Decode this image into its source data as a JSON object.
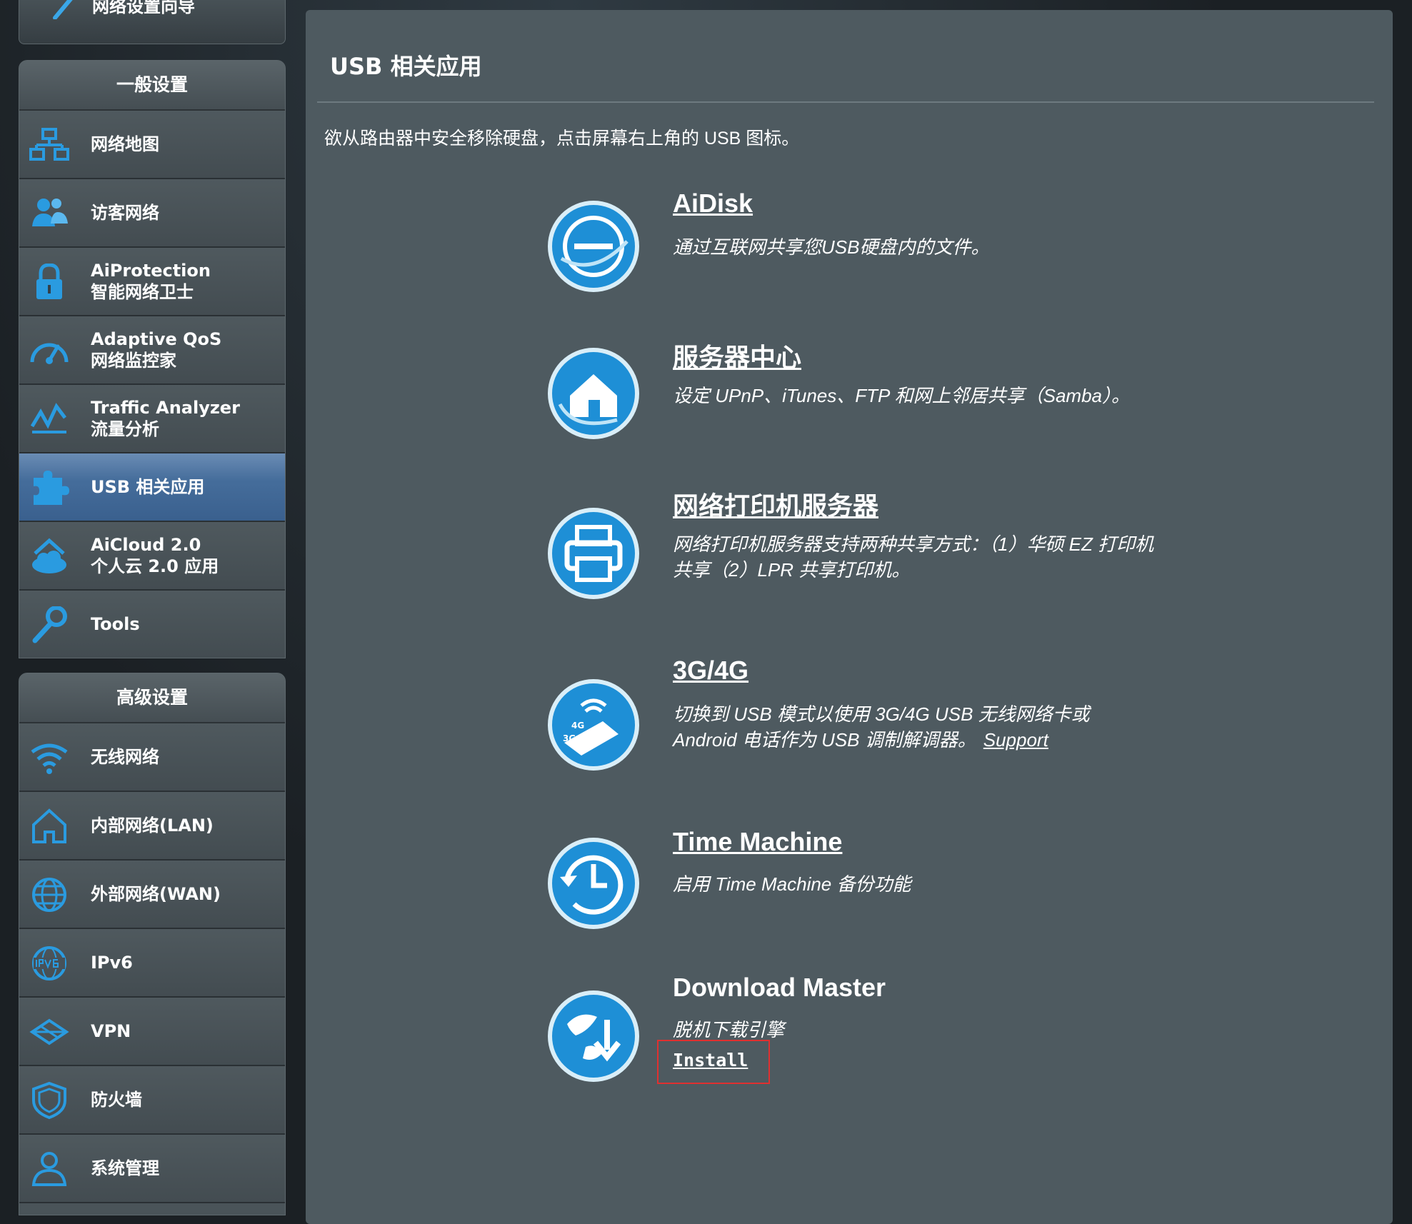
{
  "sidebar": {
    "wizard_label": "网络设置向导",
    "general_header": "一般设置",
    "general_items": [
      {
        "line1": "网络地图",
        "line2": "",
        "icon": "network-map-icon"
      },
      {
        "line1": "访客网络",
        "line2": "",
        "icon": "guest-network-icon"
      },
      {
        "line1": "AiProtection",
        "line2": "智能网络卫士",
        "icon": "lock-icon"
      },
      {
        "line1": "Adaptive QoS",
        "line2": "网络监控家",
        "icon": "speedometer-icon"
      },
      {
        "line1": "Traffic Analyzer",
        "line2": "流量分析",
        "icon": "traffic-chart-icon"
      },
      {
        "line1": "USB 相关应用",
        "line2": "",
        "icon": "puzzle-icon"
      },
      {
        "line1": "AiCloud 2.0",
        "line2": "个人云 2.0 应用",
        "icon": "cloud-home-icon"
      },
      {
        "line1": "Tools",
        "line2": "",
        "icon": "wrench-icon"
      }
    ],
    "advanced_header": "高级设置",
    "advanced_items": [
      {
        "line1": "无线网络",
        "icon": "wifi-icon"
      },
      {
        "line1": "内部网络(LAN)",
        "icon": "home-icon"
      },
      {
        "line1": "外部网络(WAN)",
        "icon": "globe-icon"
      },
      {
        "line1": "IPv6",
        "icon": "ipv6-globe-icon"
      },
      {
        "line1": "VPN",
        "icon": "vpn-icon"
      },
      {
        "line1": "防火墙",
        "icon": "shield-icon"
      },
      {
        "line1": "系统管理",
        "icon": "user-icon"
      }
    ]
  },
  "main": {
    "title": "USB 相关应用",
    "intro": "欲从路由器中安全移除硬盘，点击屏幕右上角的 USB 图标。",
    "apps": [
      {
        "name": "AiDisk",
        "desc": "通过互联网共享您USB硬盘内的文件。",
        "icon": "aidisk-icon"
      },
      {
        "name": "服务器中心",
        "desc": "设定 UPnP、iTunes、FTP 和网上邻居共享（Samba）。",
        "icon": "server-center-icon"
      },
      {
        "name": "网络打印机服务器",
        "desc": "网络打印机服务器支持两种共享方式：（1）华硕 EZ 打印机共享（2）LPR 共享打印机。",
        "icon": "printer-icon"
      },
      {
        "name": "3G/4G",
        "desc": "切换到 USB 模式以使用 3G/4G USB 无线网络卡或 Android 电话作为 USB 调制解调器。",
        "link": "Support",
        "icon": "usb-modem-icon"
      },
      {
        "name": "Time Machine",
        "desc": "启用 Time Machine 备份功能",
        "icon": "time-machine-icon"
      },
      {
        "name": "Download Master",
        "desc": "脱机下载引擎",
        "install": "Install",
        "icon": "download-master-icon"
      }
    ]
  },
  "colors": {
    "main_bg": "#4e5a60",
    "sidebar_bg": "#4a5459",
    "active_item": "#3a608e",
    "icon_blue": "#1e8fd6",
    "highlight_box": "#e03030"
  }
}
